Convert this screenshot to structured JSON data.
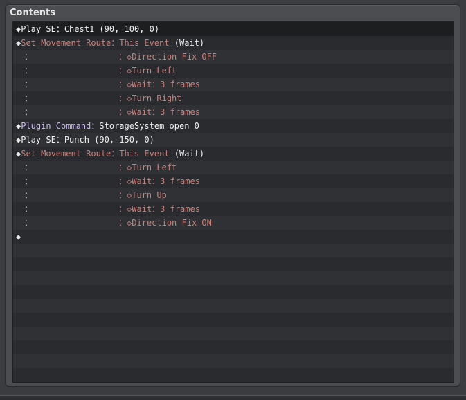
{
  "panel": {
    "title": "Contents"
  },
  "rows": [
    {
      "kind": "cmd",
      "marker": "◆",
      "cmd": "Play SE",
      "sep": "：",
      "val": "Chest1 (90, 100, 0)",
      "style": "c1"
    },
    {
      "kind": "cmd",
      "marker": "◆",
      "cmd": "Set Movement Route",
      "sep": "：",
      "val": "This Event",
      "extra": " (Wait)",
      "style": "c2"
    },
    {
      "kind": "sub",
      "cont": "：",
      "sep": "：",
      "marker": "◇",
      "text": "Direction Fix OFF"
    },
    {
      "kind": "sub",
      "cont": "：",
      "sep": "：",
      "marker": "◇",
      "text": "Turn Left"
    },
    {
      "kind": "sub",
      "cont": "：",
      "sep": "：",
      "marker": "◇",
      "text": "Wait：3 frames"
    },
    {
      "kind": "sub",
      "cont": "：",
      "sep": "：",
      "marker": "◇",
      "text": "Turn Right"
    },
    {
      "kind": "sub",
      "cont": "：",
      "sep": "：",
      "marker": "◇",
      "text": "Wait：3 frames"
    },
    {
      "kind": "cmd",
      "marker": "◆",
      "cmd": "Plugin Command",
      "sep": "：",
      "val": "StorageSystem open 0",
      "style": "cp"
    },
    {
      "kind": "cmd",
      "marker": "◆",
      "cmd": "Play SE",
      "sep": "：",
      "val": "Punch (90, 150, 0)",
      "style": "c1"
    },
    {
      "kind": "cmd",
      "marker": "◆",
      "cmd": "Set Movement Route",
      "sep": "：",
      "val": "This Event",
      "extra": " (Wait)",
      "style": "c2"
    },
    {
      "kind": "sub",
      "cont": "：",
      "sep": "：",
      "marker": "◇",
      "text": "Turn Left"
    },
    {
      "kind": "sub",
      "cont": "：",
      "sep": "：",
      "marker": "◇",
      "text": "Wait：3 frames"
    },
    {
      "kind": "sub",
      "cont": "：",
      "sep": "：",
      "marker": "◇",
      "text": "Turn Up"
    },
    {
      "kind": "sub",
      "cont": "：",
      "sep": "：",
      "marker": "◇",
      "text": "Wait：3 frames"
    },
    {
      "kind": "sub",
      "cont": "：",
      "sep": "：",
      "marker": "◇",
      "text": "Direction Fix ON"
    },
    {
      "kind": "empty",
      "marker": "◆"
    }
  ],
  "colors": {
    "play_se": "#f0f0f0",
    "movement_route": "#d07c76",
    "plugin_command": "#c9b8ee"
  }
}
